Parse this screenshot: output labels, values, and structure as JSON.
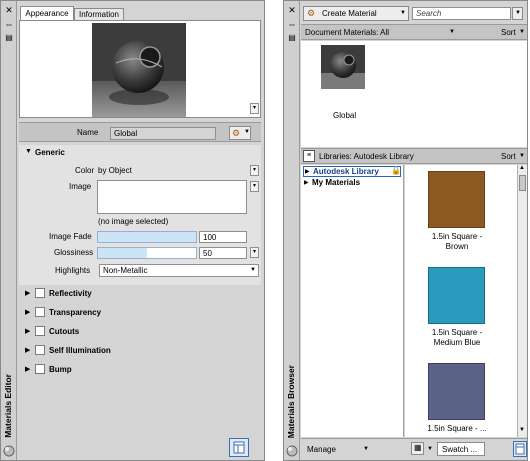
{
  "editor": {
    "title": "Materials Editor",
    "tabs": [
      "Appearance",
      "Information"
    ],
    "name_label": "Name",
    "name_value": "Global",
    "generic": {
      "header": "Generic",
      "color_label": "Color",
      "color_value": "by Object",
      "image_label": "Image",
      "image_note": "(no image selected)",
      "image_fade_label": "Image Fade",
      "image_fade_value": "100",
      "image_fade_fraction": 1.0,
      "glossiness_label": "Glossiness",
      "glossiness_value": "50",
      "glossiness_fraction": 0.5,
      "highlights_label": "Highlights",
      "highlights_value": "Non-Metallic"
    },
    "sections": [
      "Reflectivity",
      "Transparency",
      "Cutouts",
      "Self Illumination",
      "Bump"
    ]
  },
  "browser": {
    "title": "Materials Browser",
    "create_label": "Create Material",
    "search_placeholder": "Search",
    "doc_materials_label": "Document Materials: All",
    "sort_label": "Sort",
    "doc_item_label": "Global",
    "libraries_label": "Libraries: Autodesk Library",
    "tree": [
      "Autodesk Library",
      "My Materials"
    ],
    "swatches": [
      {
        "label": "1.5in Square - Brown",
        "color": "#8a5a22"
      },
      {
        "label": "1.5in Square - Medium Blue",
        "color": "#2a9bbd"
      },
      {
        "label": "1.5in Square - ...",
        "color": "#5a6288"
      }
    ],
    "manage_label": "Manage",
    "swatch_button_label": "Swatch ..."
  },
  "colors": {
    "panel_bg": "#d4d4d4",
    "header_bar": "#c4c4c4",
    "selection_blue": "#2c61b8",
    "slider_fill": "#cce4f7"
  }
}
